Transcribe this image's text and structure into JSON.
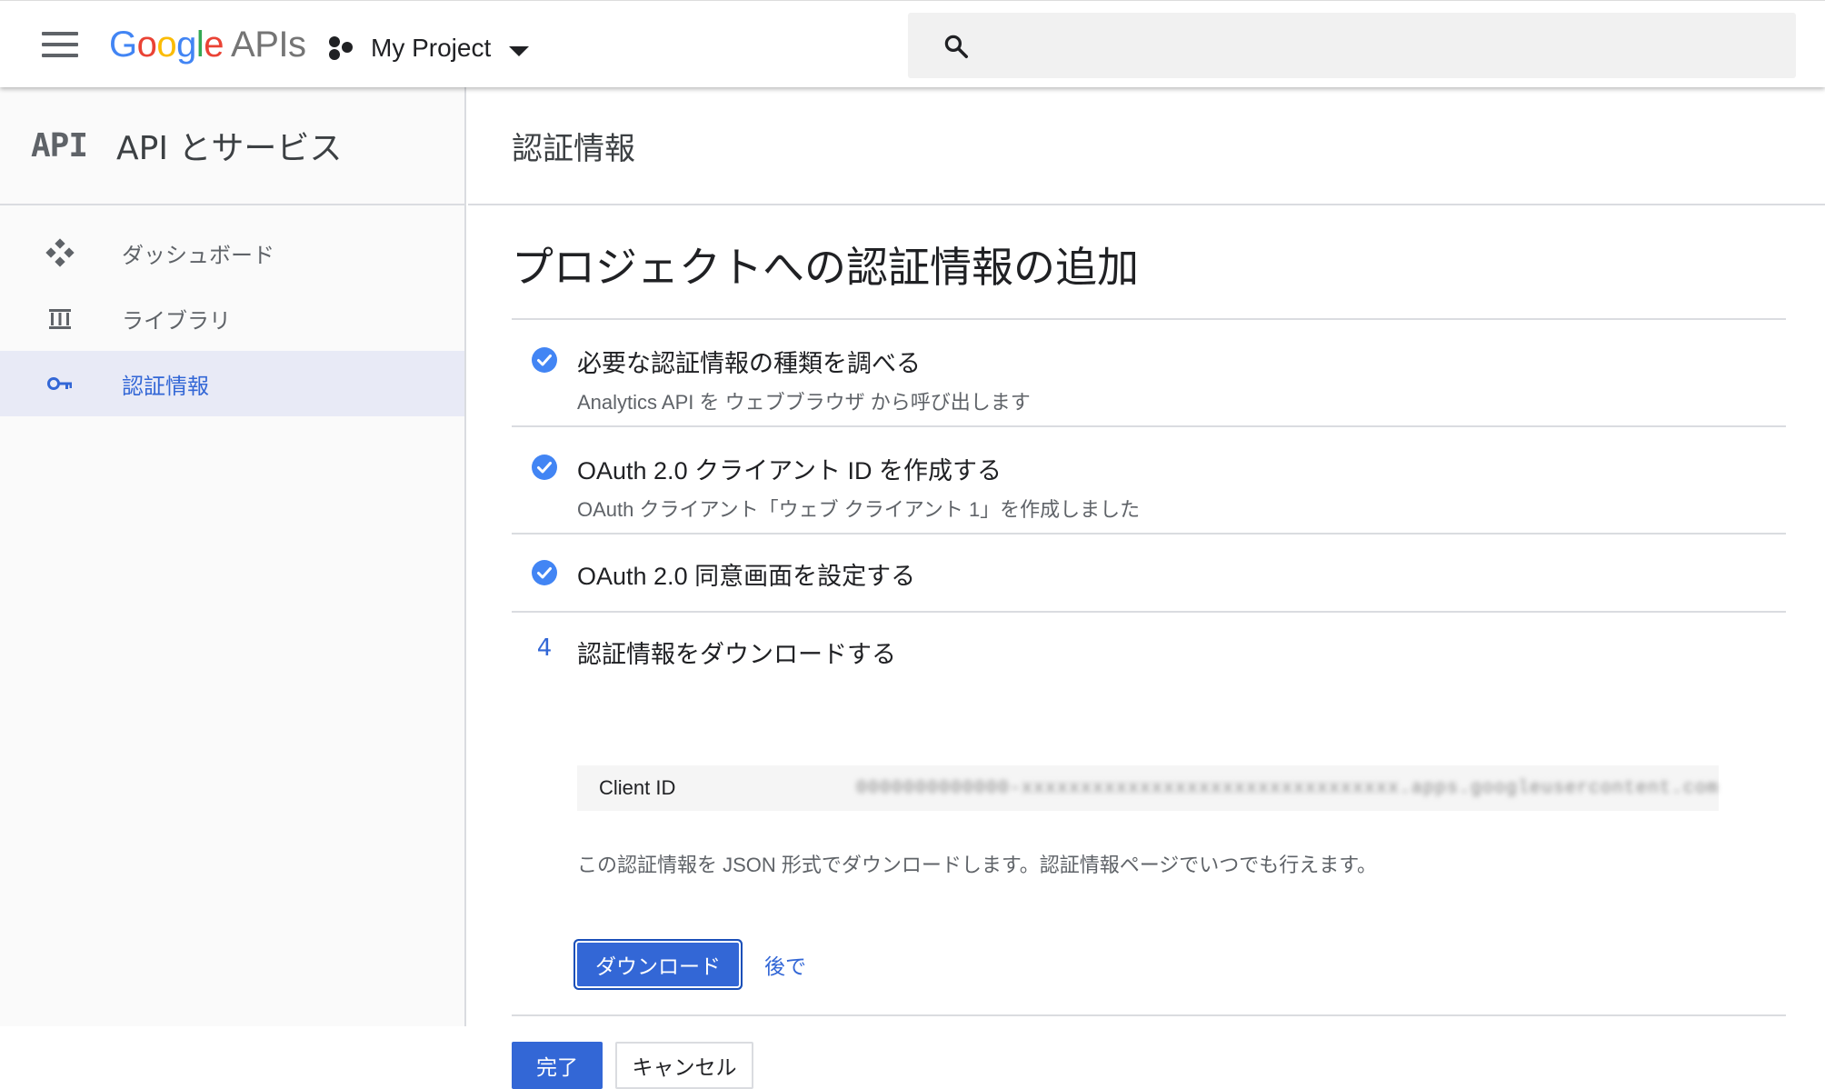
{
  "topbar": {
    "logo": {
      "letters": [
        "G",
        "o",
        "o",
        "g",
        "l",
        "e"
      ],
      "suffix": "APIs"
    },
    "project_name": "My Project",
    "search_placeholder": ""
  },
  "sidebar": {
    "badge": "API",
    "title": "API とサービス",
    "items": [
      {
        "label": "ダッシュボード",
        "icon": "dashboard-icon",
        "active": false
      },
      {
        "label": "ライブラリ",
        "icon": "library-icon",
        "active": false
      },
      {
        "label": "認証情報",
        "icon": "key-icon",
        "active": true
      }
    ]
  },
  "main": {
    "header_title": "認証情報",
    "page_title": "プロジェクトへの認証情報の追加",
    "steps": [
      {
        "status": "done",
        "title": "必要な認証情報の種類を調べる",
        "subtitle": "Analytics API を ウェブブラウザ から呼び出します"
      },
      {
        "status": "done",
        "title": "OAuth 2.0 クライアント ID を作成する",
        "subtitle": "OAuth クライアント「ウェブ クライアント 1」を作成しました"
      },
      {
        "status": "done",
        "title": "OAuth 2.0 同意画面を設定する",
        "subtitle": ""
      },
      {
        "status": "current",
        "number": "4",
        "title": "認証情報をダウンロードする",
        "subtitle": ""
      }
    ],
    "client_id": {
      "label": "Client ID",
      "value": "0000000000000-xxxxxxxxxxxxxxxxxxxxxxxxxxxxxxxx.apps.googleusercontent.com"
    },
    "download_text": "この認証情報を JSON 形式でダウンロードします。認証情報ページでいつでも行えます。",
    "download_button": "ダウンロード",
    "later_link": "後で",
    "done_button": "完了",
    "cancel_button": "キャンセル"
  },
  "colors": {
    "accent": "#3367d6",
    "check": "#4285f4",
    "active_nav_bg": "#e8eaf6",
    "google_blue": "#4285f4",
    "google_red": "#ea4335",
    "google_yellow": "#fbbc05",
    "google_green": "#34a853"
  }
}
